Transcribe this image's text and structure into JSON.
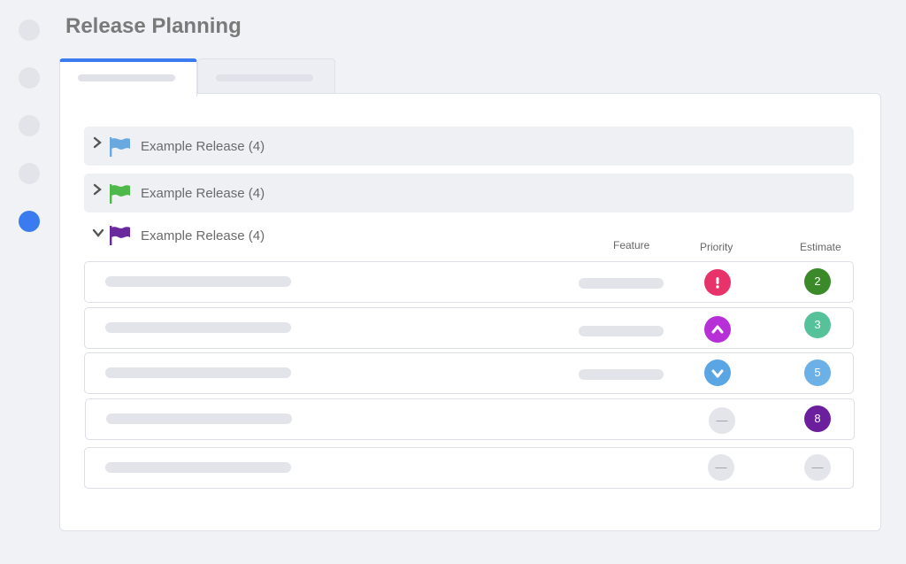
{
  "page": {
    "title": "Release Planning"
  },
  "colors": {
    "accent": "#3a7cf0",
    "flag_blue": "#6aa9e0",
    "flag_green": "#4fb84a",
    "flag_purple": "#6a2a9e",
    "priority_urgent": "#e8336a",
    "priority_high": "#b72fd6",
    "priority_low": "#5aa6e4",
    "estimate_2": "#3b8a2a",
    "estimate_3": "#55c29a",
    "estimate_5": "#6bb0e6",
    "estimate_8": "#6b1f9e"
  },
  "releases": [
    {
      "label": "Example Release (4)",
      "expanded": false,
      "flag_icon": "flag-icon",
      "flag_color": "#6aa9e0"
    },
    {
      "label": "Example Release (4)",
      "expanded": false,
      "flag_icon": "flag-icon",
      "flag_color": "#4fb84a"
    },
    {
      "label": "Example Release (4)",
      "expanded": true,
      "flag_icon": "flag-icon",
      "flag_color": "#6a2a9e"
    }
  ],
  "columns": {
    "feature": "Feature",
    "priority": "Priority",
    "estimate": "Estimate"
  },
  "items": [
    {
      "priority": "urgent",
      "priority_icon": "exclamation-icon",
      "estimate": "2"
    },
    {
      "priority": "high",
      "priority_icon": "chevron-up-icon",
      "estimate": "3"
    },
    {
      "priority": "low",
      "priority_icon": "chevron-down-icon",
      "estimate": "5"
    },
    {
      "priority": "none",
      "priority_icon": "dash-icon",
      "estimate": "8"
    },
    {
      "priority": "none",
      "priority_icon": "dash-icon",
      "estimate": "—"
    }
  ],
  "empty_glyph": "—"
}
